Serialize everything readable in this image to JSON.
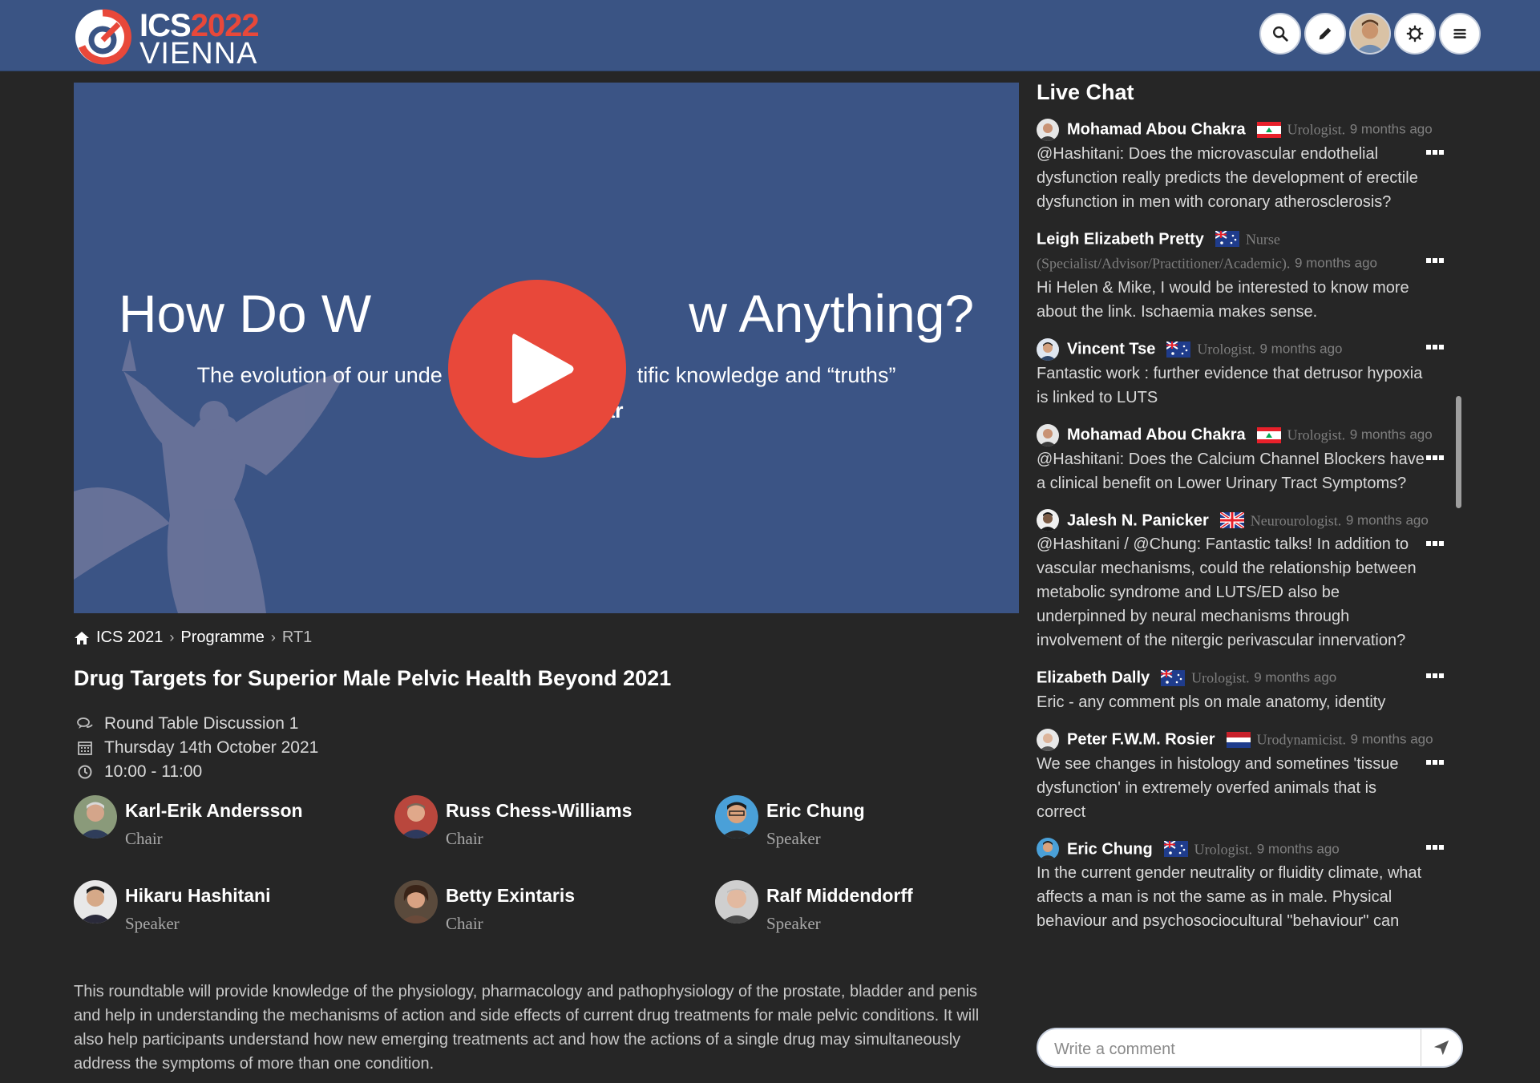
{
  "header": {
    "logo_line1": "ICS",
    "logo_year": "2022",
    "logo_line2": "VIENNA",
    "buttons": [
      "search-icon",
      "pencil-icon",
      "avatar",
      "gear-icon",
      "menu-icon"
    ]
  },
  "video": {
    "title": "How Do W      w Anything?",
    "subtitle": "The evolution of our unde         tific knowledge and “truths”",
    "subtitle2": "ar"
  },
  "breadcrumb": {
    "home": "ICS 2021",
    "programme": "Programme",
    "current": "RT1"
  },
  "session": {
    "title": "Drug Targets for Superior Male Pelvic Health Beyond 2021",
    "type": "Round Table Discussion 1",
    "date": "Thursday 14th October 2021",
    "time": "10:00 - 11:00"
  },
  "speakers": [
    {
      "name": "Karl-Erik Andersson",
      "role": "Chair"
    },
    {
      "name": "Russ Chess-Williams",
      "role": "Chair"
    },
    {
      "name": "Eric Chung",
      "role": "Speaker"
    },
    {
      "name": "Hikaru Hashitani",
      "role": "Speaker"
    },
    {
      "name": "Betty Exintaris",
      "role": "Chair"
    },
    {
      "name": "Ralf Middendorff",
      "role": "Speaker"
    }
  ],
  "description": "This roundtable will provide knowledge of the physiology, pharmacology and pathophysiology of the prostate, bladder and penis and help in understanding the mechanisms of action and side effects of current drug treatments for male pelvic conditions. It will also help participants understand how new emerging treatments act and how the actions of a single drug may simultaneously address the symptoms of more than one condition.",
  "chat": {
    "title": "Live Chat",
    "messages": [
      {
        "name": "Mohamad Abou Chakra",
        "flag": "lebanon",
        "role": "Urologist.",
        "ago": "9 months ago",
        "text": "@Hashitani: Does the microvascular endothelial dysfunction really predicts the development of erectile dysfunction in men with coronary atherosclerosis?"
      },
      {
        "name": "Leigh Elizabeth Pretty",
        "flag": "australia",
        "role": "Nurse (Specialist/Advisor/Practitioner/Academic).",
        "ago": "9 months ago",
        "text": "Hi Helen & Mike, I would be interested to know more about the link. Ischaemia makes sense."
      },
      {
        "name": "Vincent Tse",
        "flag": "australia",
        "role": "Urologist.",
        "ago": "9 months ago",
        "text": "Fantastic work : further evidence that detrusor hypoxia is linked to LUTS"
      },
      {
        "name": "Mohamad Abou Chakra",
        "flag": "lebanon",
        "role": "Urologist.",
        "ago": "9 months ago",
        "text": "@Hashitani: Does the Calcium Channel Blockers have a clinical benefit on Lower Urinary Tract Symptoms?"
      },
      {
        "name": "Jalesh N. Panicker",
        "flag": "uk",
        "role": "Neurourologist.",
        "ago": "9 months ago",
        "text": "@Hashitani / @Chung: Fantastic talks! In addition to vascular mechanisms, could the relationship between metabolic syndrome and LUTS/ED also be underpinned by neural mechanisms through involvement of the nitergic perivascular innervation?"
      },
      {
        "name": "Elizabeth Dally",
        "flag": "australia",
        "role": "Urologist.",
        "ago": "9 months ago",
        "text": "Eric - any comment pls on male anatomy, identity"
      },
      {
        "name": "Peter F.W.M. Rosier",
        "flag": "netherlands",
        "role": "Urodynamicist.",
        "ago": "9 months ago",
        "text": "We see changes in histology and sometines 'tissue dysfunction' in extremely overfed animals that is correct"
      },
      {
        "name": "Eric Chung",
        "flag": "australia",
        "role": "Urologist.",
        "ago": "9 months ago",
        "text": "In the current gender neutrality or fluidity climate, what affects a man is not the same as in male. Physical behaviour and psychosociocultural \"behaviour\" can"
      }
    ],
    "comment_placeholder": "Write a comment"
  },
  "colors": {
    "header_bg": "#3a5484",
    "page_bg": "#262626",
    "accent_red": "#e8483a",
    "video_bg": "#3b5485"
  }
}
